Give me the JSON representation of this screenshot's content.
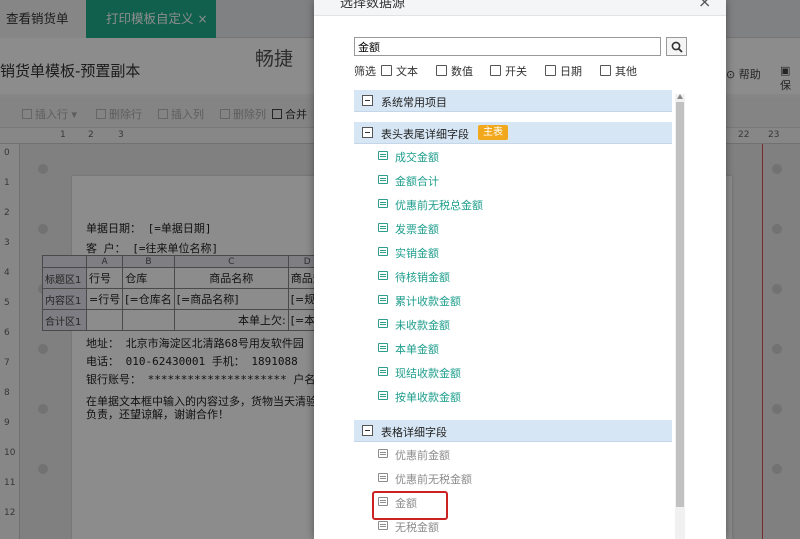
{
  "tabs": [
    {
      "label": "查看销货单"
    },
    {
      "label": "打印模板自定义",
      "close": "×"
    }
  ],
  "page_title": "销货单模板-预置副本",
  "header_right": {
    "help": "帮助",
    "save": "保"
  },
  "toolbar": {
    "insert_row": "插入行",
    "delete_row": "删除行",
    "insert_col": "插入列",
    "delete_col": "删除列",
    "merge": "合并"
  },
  "ruler_top": [
    "1",
    "2",
    "3",
    "22",
    "23"
  ],
  "ruler_left": [
    "0",
    "1",
    "2",
    "3",
    "4",
    "5",
    "6",
    "7",
    "8",
    "9",
    "10",
    "11",
    "12"
  ],
  "document": {
    "title": "畅捷",
    "date_line": "单据日期： [=单据日期]",
    "customer_line": "客    户： [=往来单位名称]",
    "table": {
      "col_heads": [
        "A",
        "B",
        "C",
        "D"
      ],
      "rows": [
        {
          "head": "标题区1",
          "cells": [
            "行号",
            "仓库",
            "商品名称",
            "商品规"
          ]
        },
        {
          "head": "内容区1",
          "cells": [
            "=行号",
            "[=仓库名",
            "[=商品名称]",
            "[=规"
          ]
        },
        {
          "head": "合计区1",
          "cells": [
            "",
            "",
            "本单上欠:",
            "[=本"
          ]
        }
      ]
    },
    "address_line": "地址： 北京市海淀区北清路68号用友软件园",
    "phone_line": "电话： 010-62430001         手机： 1891088",
    "bank_line": "银行账号： *********************     户名：*",
    "note_line1": "在单据文本框中输入的内容过多，货物当天清验",
    "note_line2": "负责，还望谅解，谢谢合作！"
  },
  "modal": {
    "title": "选择数据源",
    "close": "×",
    "search": {
      "value": "金额"
    },
    "filter_label": "筛选",
    "filters": [
      "文本",
      "数值",
      "开关",
      "日期",
      "其他"
    ],
    "groups": [
      {
        "label": "系统常用项目",
        "items": []
      },
      {
        "label": "表头表尾详细字段",
        "badge": "主表",
        "items": [
          "成交金额",
          "金额合计",
          "优惠前无税总金额",
          "发票金额",
          "实销金额",
          "待核销金额",
          "累计收款金额",
          "未收款金额",
          "本单金额",
          "现结收款金额",
          "按单收款金额"
        ]
      },
      {
        "label": "表格详细字段",
        "items": [
          "优惠前金额",
          "优惠前无税金额",
          "金额",
          "无税金额"
        ]
      }
    ]
  },
  "colors": {
    "accent": "#1fb08f",
    "badge": "#f2a81c",
    "highlight": "#cc2222",
    "group_bg": "#d7e6f4"
  }
}
